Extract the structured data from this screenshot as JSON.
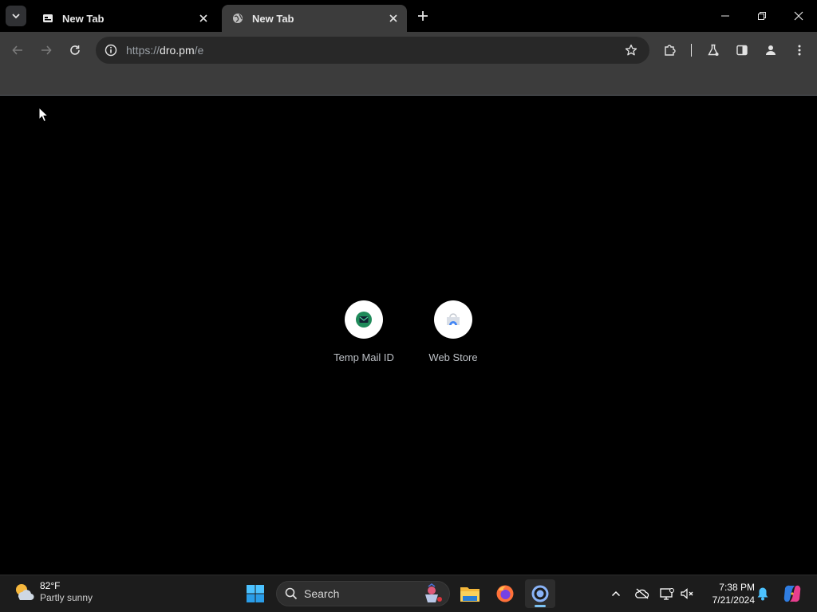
{
  "browser": {
    "tabs": [
      {
        "title": "New Tab",
        "favicon": "temp-mail-favicon",
        "active": false
      },
      {
        "title": "New Tab",
        "favicon": "globe-icon",
        "active": true
      }
    ],
    "url": {
      "scheme": "https://",
      "host": "dro.pm",
      "path": "/e"
    }
  },
  "shortcuts": [
    {
      "label": "Temp Mail ID",
      "icon": "temp-mail-icon"
    },
    {
      "label": "Web Store",
      "icon": "web-store-icon"
    }
  ],
  "taskbar": {
    "weather": {
      "temp": "82°F",
      "condition": "Partly sunny"
    },
    "search_placeholder": "Search",
    "clock": {
      "time": "7:38 PM",
      "date": "7/21/2024"
    }
  },
  "colors": {
    "page_background": "#000000",
    "toolbar": "#3c3c3c",
    "taskbar": "#1c1c1c",
    "accent": "#7cc4f4"
  }
}
